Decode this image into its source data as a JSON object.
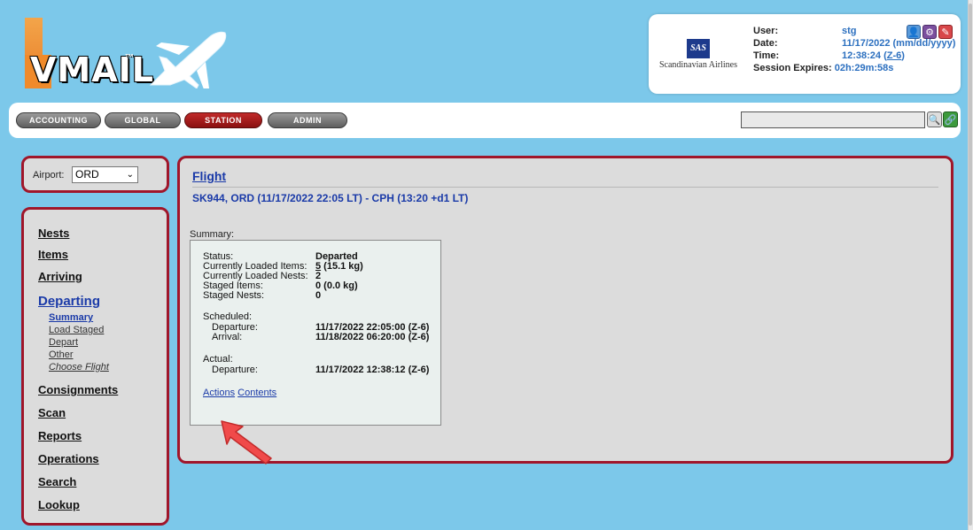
{
  "logo": {
    "text": "VMAIL",
    "tm": "™"
  },
  "airline": {
    "name": "Scandinavian Airlines",
    "mark": "SAS"
  },
  "session": {
    "user_label": "User:",
    "user_value": "stg",
    "date_label": "Date:",
    "date_value": "11/17/2022 (mm/dd/yyyy)",
    "time_label": "Time:",
    "time_value": "12:38:24 (",
    "time_zone": "Z-6",
    "time_close": ")",
    "expires_label": "Session Expires:",
    "expires_value": "02h:29m:58s"
  },
  "tabs": [
    {
      "label": "ACCOUNTING"
    },
    {
      "label": "GLOBAL"
    },
    {
      "label": "STATION"
    },
    {
      "label": "ADMIN"
    }
  ],
  "search": {
    "value": ""
  },
  "airport": {
    "label": "Airport:",
    "selected": "ORD"
  },
  "nav": {
    "items": [
      {
        "label": "Nests"
      },
      {
        "label": "Items"
      },
      {
        "label": "Arriving"
      },
      {
        "label": "Departing"
      },
      {
        "label": "Consignments"
      },
      {
        "label": "Scan"
      },
      {
        "label": "Reports"
      },
      {
        "label": "Operations"
      },
      {
        "label": "Search"
      },
      {
        "label": "Lookup"
      }
    ],
    "sub_items": [
      {
        "label": "Summary"
      },
      {
        "label": "Load Staged"
      },
      {
        "label": "Depart"
      },
      {
        "label": "Other"
      },
      {
        "label": "Choose Flight"
      }
    ]
  },
  "main": {
    "title": "Flight",
    "subtitle": "SK944, ORD (11/17/2022 22:05 LT) - CPH (13:20 +d1 LT)",
    "summary_label": "Summary:",
    "status_label": "Status:",
    "status_value": "Departed",
    "loaded_items_label": "Currently Loaded Items:",
    "loaded_items_count": "5",
    "loaded_items_weight": " (15.1 kg)",
    "loaded_nests_label": "Currently Loaded Nests:",
    "loaded_nests_value": "2",
    "staged_items_label": "Staged Items:",
    "staged_items_value": "0 (0.0 kg)",
    "staged_nests_label": "Staged Nests:",
    "staged_nests_value": "0",
    "scheduled_label": "Scheduled:",
    "sched_departure_label": "Departure:",
    "sched_departure_value": "11/17/2022 22:05:00 (Z-6)",
    "sched_arrival_label": "Arrival:",
    "sched_arrival_value": "11/18/2022 06:20:00 (Z-6)",
    "actual_label": "Actual:",
    "actual_departure_label": "Departure:",
    "actual_departure_value": "11/17/2022 12:38:12 (Z-6)",
    "actions_link": "Actions",
    "contents_link": "Contents"
  },
  "colors": {
    "accent_red": "#a0162a",
    "link_blue": "#1a3aa8",
    "background": "#7cc8ea"
  }
}
